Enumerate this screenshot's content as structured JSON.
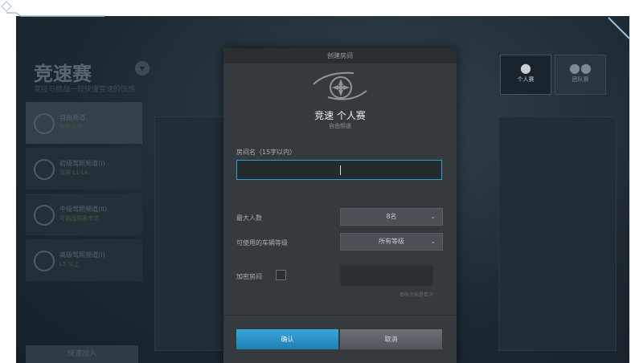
{
  "background": {
    "title": "竞速赛",
    "subtitle": "竞技与挑战一较快慢竞速的快感",
    "menu": [
      {
        "label": "自由频道",
        "sub": "新手入场"
      },
      {
        "label": "初级驾照频道(I)",
        "sub": "驾照 L1-L4"
      },
      {
        "label": "中级驾照频道(II)",
        "sub": "可挑战驾照考试"
      },
      {
        "label": "高级驾照频道(I)",
        "sub": "L5 以上"
      }
    ],
    "bottom_button": "快速加入",
    "modes": [
      {
        "label": "个人赛",
        "icon": "single-player-icon"
      },
      {
        "label": "团队赛",
        "icon": "team-icon"
      }
    ]
  },
  "modal": {
    "title": "创建房间",
    "game_mode": "竞速 个人赛",
    "channel": "自由频道",
    "room_name_label": "房间名（15字以内）",
    "room_name_value": "",
    "max_players_label": "最大人数",
    "max_players_value": "8名",
    "vehicle_grade_label": "可使用的车辆等级",
    "vehicle_grade_value": "所有等级",
    "password_label": "加密房间",
    "password_checked": false,
    "password_hint": "密码只能是数字",
    "confirm_label": "确认",
    "cancel_label": "取消"
  },
  "colors": {
    "accent": "#2f9ed6",
    "modal_bg": "#353a3e",
    "backdrop": "#1c2730"
  }
}
